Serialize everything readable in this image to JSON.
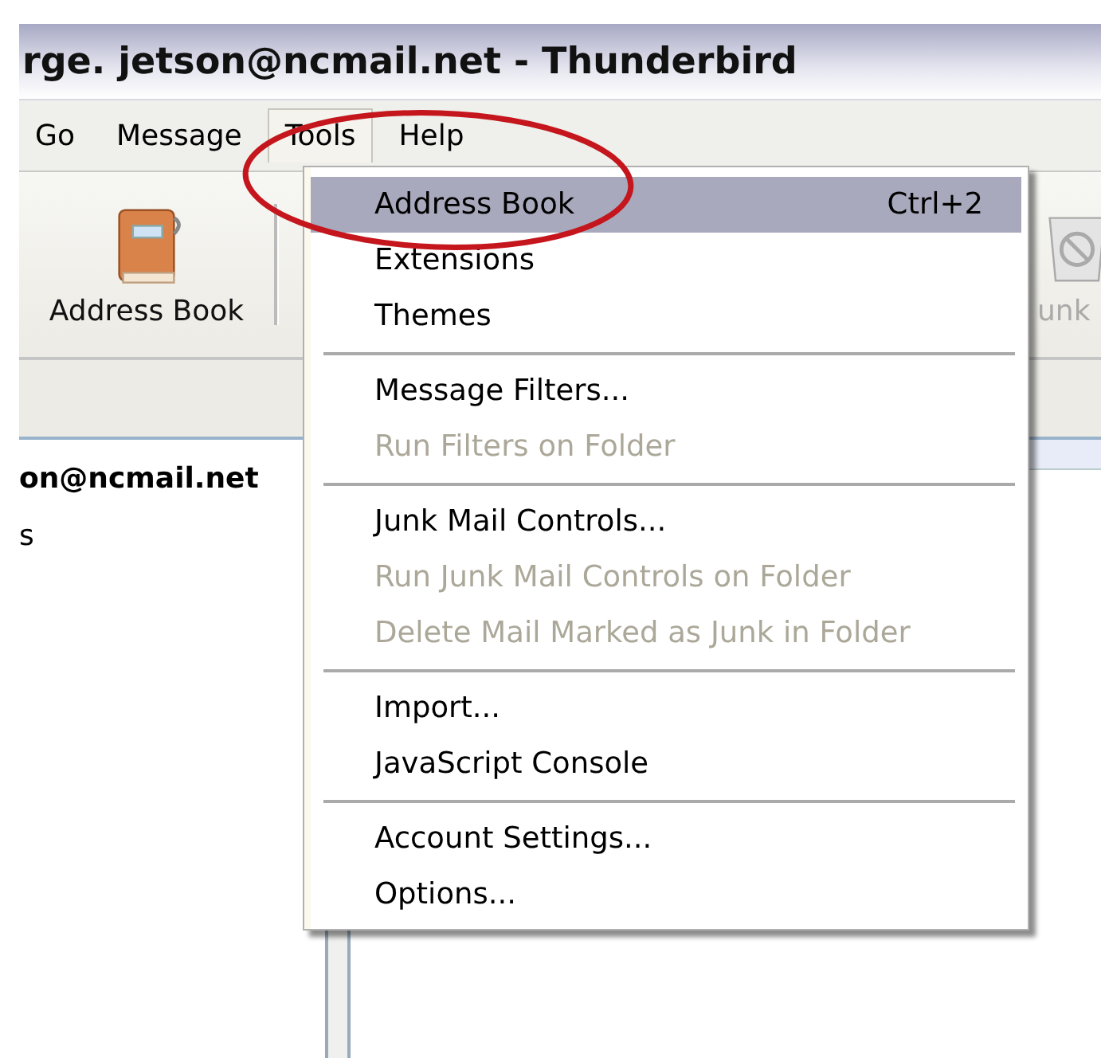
{
  "window": {
    "title": "rge. jetson@ncmail.net - Thunderbird"
  },
  "menubar": [
    {
      "label": "Go",
      "selected": false
    },
    {
      "label": "Message",
      "selected": false
    },
    {
      "label": "Tools",
      "selected": true
    },
    {
      "label": "Help",
      "selected": false
    }
  ],
  "toolbar": [
    {
      "label": "Address Book",
      "kind": "book",
      "disabled": false
    },
    {
      "label": "unk",
      "kind": "trash",
      "disabled": true
    }
  ],
  "folder_pane": [
    "on@ncmail.net",
    "s"
  ],
  "menu": [
    {
      "kind": "item",
      "label": "Address Book",
      "shortcut": "Ctrl+2",
      "selected": true,
      "disabled": false
    },
    {
      "kind": "item",
      "label": "Extensions",
      "selected": false,
      "disabled": false
    },
    {
      "kind": "item",
      "label": "Themes",
      "selected": false,
      "disabled": false
    },
    {
      "kind": "separator"
    },
    {
      "kind": "item",
      "label": "Message Filters...",
      "selected": false,
      "disabled": false
    },
    {
      "kind": "item",
      "label": "Run Filters on Folder",
      "selected": false,
      "disabled": true
    },
    {
      "kind": "separator"
    },
    {
      "kind": "item",
      "label": "Junk Mail Controls...",
      "selected": false,
      "disabled": false
    },
    {
      "kind": "item",
      "label": "Run Junk Mail Controls on Folder",
      "selected": false,
      "disabled": true
    },
    {
      "kind": "item",
      "label": "Delete Mail Marked as Junk in Folder",
      "selected": false,
      "disabled": true
    },
    {
      "kind": "separator"
    },
    {
      "kind": "item",
      "label": "Import...",
      "selected": false,
      "disabled": false
    },
    {
      "kind": "item",
      "label": "JavaScript Console",
      "selected": false,
      "disabled": false
    },
    {
      "kind": "separator"
    },
    {
      "kind": "item",
      "label": "Account Settings...",
      "selected": false,
      "disabled": false
    },
    {
      "kind": "item",
      "label": "Options...",
      "selected": false,
      "disabled": false
    }
  ]
}
